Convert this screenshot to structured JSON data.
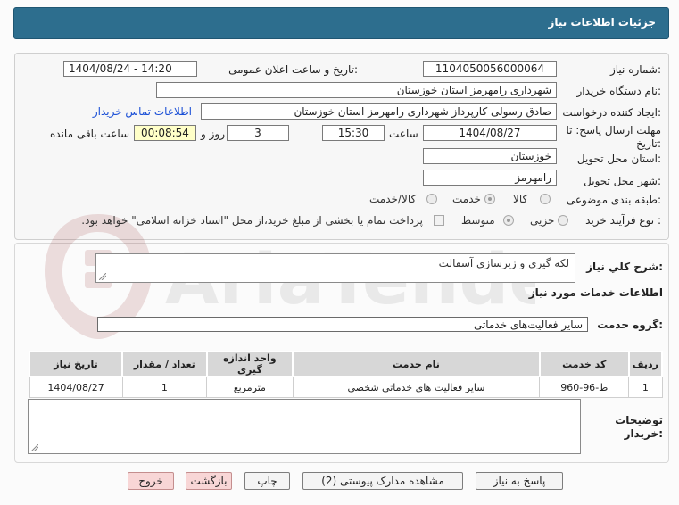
{
  "header": {
    "title": "جزئیات اطلاعات نیاز"
  },
  "details": {
    "need_number_label": "شماره نیاز:",
    "need_number": "1104050056000064",
    "announce_label": "تاریخ و ساعت اعلان عمومی:",
    "announce_value": "1404/08/24 - 14:20",
    "buyer_org_label": "نام دستگاه خریدار:",
    "buyer_org": "شهرداری رامهرمز استان خوزستان",
    "creator_label": "ایجاد کننده درخواست:",
    "creator": "صادق رسولی کارپرداز شهرداری رامهرمز استان خوزستان",
    "contact_link": "اطلاعات تماس خریدار",
    "deadline_label_1": "مهلت ارسال پاسخ: تا",
    "deadline_label_2": "تاریخ:",
    "deadline_date": "1404/08/27",
    "hour_label": "ساعت",
    "deadline_hour": "15:30",
    "days_value": "3",
    "days_label": "روز و",
    "remaining_time": "00:08:54",
    "remaining_label": "ساعت باقی مانده",
    "province_label": "استان محل تحویل:",
    "province": "خوزستان",
    "city_label": "شهر محل تحویل:",
    "city": "رامهرمز",
    "category_label": "طبقه بندی موضوعی:",
    "category_options": [
      "کالا",
      "خدمت",
      "کالا/خدمت"
    ],
    "category_selected": "خدمت",
    "process_label": "نوع فرآیند خرید :",
    "process_options": [
      "جزیی",
      "متوسط"
    ],
    "process_selected": "متوسط",
    "payment_note": "پرداخت تمام یا بخشی از مبلغ خرید،از محل \"اسناد خزانه اسلامی\" خواهد بود."
  },
  "summary": {
    "label": "شرح کلي نياز:",
    "value": "لکه گیری و زیرسازی آسفالت"
  },
  "services": {
    "section_title": "اطلاعات خدمات مورد نیاز",
    "group_label": "گروه خدمت:",
    "group_value": "سایر فعالیت‌های خدماتی",
    "table": {
      "headers": [
        "ردیف",
        "کد خدمت",
        "نام خدمت",
        "واحد اندازه گیری",
        "تعداد / مقدار",
        "تاریخ نیاز"
      ],
      "rows": [
        [
          "1",
          "ط-96-960",
          "سایر فعالیت های خدماتی شخصی",
          "مترمربع",
          "1",
          "1404/08/27"
        ]
      ]
    }
  },
  "notes": {
    "label_1": "توضیحات",
    "label_2": "خریدار:"
  },
  "buttons": {
    "reply": "پاسخ به نیاز",
    "attachments": "مشاهده مدارک پیوستی (2)",
    "print": "چاپ",
    "back": "بازگشت",
    "exit": "خروج"
  },
  "watermark": {
    "text": "AriaTender.net"
  }
}
